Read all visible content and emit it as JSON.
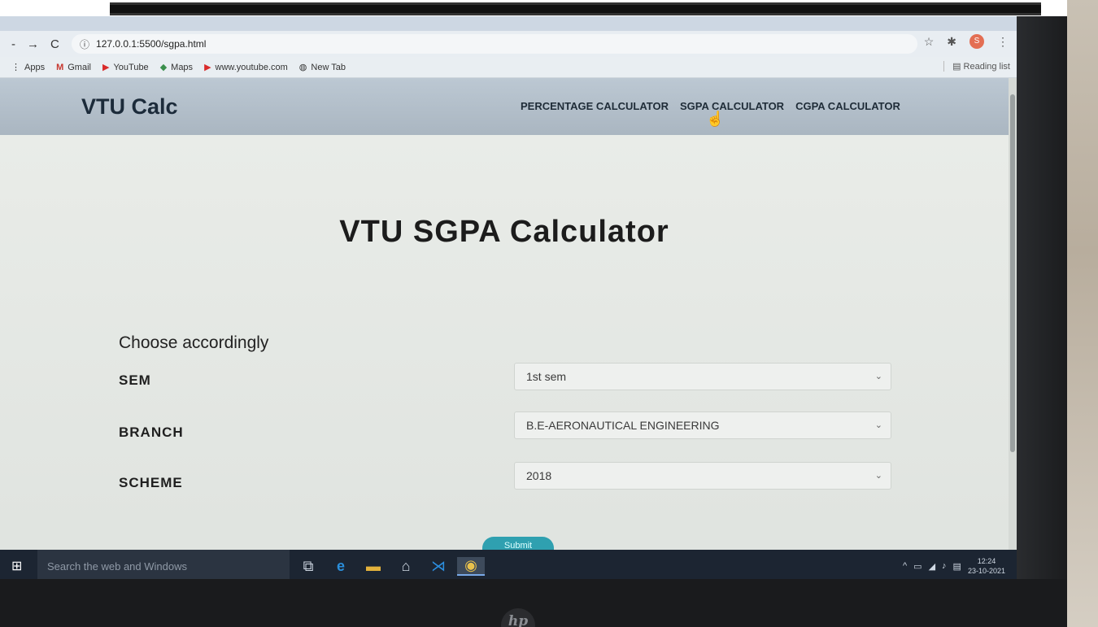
{
  "browser": {
    "url": "127.0.0.1:5500/sgpa.html",
    "bookmarks": [
      {
        "label": "Apps",
        "icon": "apps-grid-icon"
      },
      {
        "label": "Gmail",
        "icon": "gmail-icon"
      },
      {
        "label": "YouTube",
        "icon": "youtube-icon"
      },
      {
        "label": "Maps",
        "icon": "maps-icon"
      },
      {
        "label": "www.youtube.com",
        "icon": "youtube-icon"
      },
      {
        "label": "New Tab",
        "icon": "globe-icon"
      }
    ],
    "reading_list": "Reading list",
    "profile_initial": "S"
  },
  "site": {
    "brand": "VTU Calc",
    "nav": [
      "PERCENTAGE CALCULATOR",
      "SGPA CALCULATOR",
      "CGPA CALCULATOR"
    ],
    "title": "VTU SGPA Calculator",
    "choose_label": "Choose accordingly",
    "fields": [
      {
        "label": "SEM",
        "value": "1st sem"
      },
      {
        "label": "BRANCH",
        "value": "B.E-AERONAUTICAL ENGINEERING"
      },
      {
        "label": "SCHEME",
        "value": "2018"
      }
    ],
    "submit_label": "Submit"
  },
  "taskbar": {
    "search_placeholder": "Search the web and Windows",
    "time": "12:24",
    "date": "23-10-2021"
  },
  "device": {
    "logo": "hp"
  },
  "colors": {
    "header_bg": "#aab6c1",
    "submit_bg": "#2fa0b0",
    "taskbar_bg": "#1c2532"
  }
}
